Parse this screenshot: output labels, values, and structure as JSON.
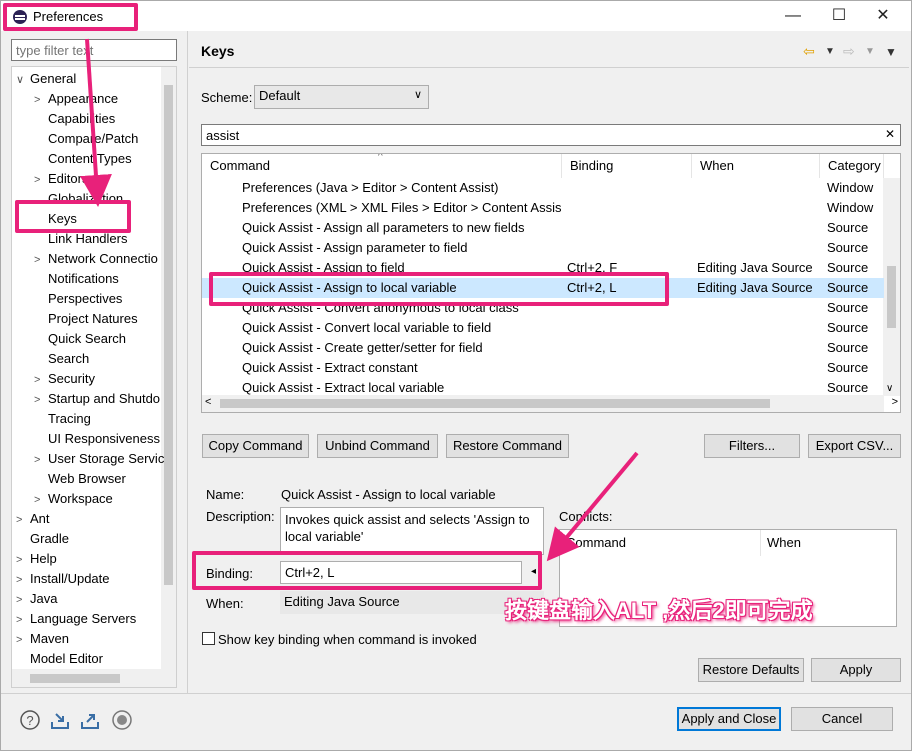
{
  "window": {
    "title": "Preferences",
    "minimize": "—",
    "maximize": "☐",
    "close": "✕"
  },
  "filter": {
    "placeholder": "type filter text"
  },
  "tree": [
    {
      "label": "General",
      "tw": "∨",
      "indent": 0
    },
    {
      "label": "Appearance",
      "tw": ">",
      "indent": 1
    },
    {
      "label": "Capabilities",
      "tw": "",
      "indent": 1
    },
    {
      "label": "Compare/Patch",
      "tw": "",
      "indent": 1
    },
    {
      "label": "Content Types",
      "tw": "",
      "indent": 1
    },
    {
      "label": "Editors",
      "tw": ">",
      "indent": 1
    },
    {
      "label": "Globalization",
      "tw": "",
      "indent": 1
    },
    {
      "label": "Keys",
      "tw": "",
      "indent": 1
    },
    {
      "label": "Link Handlers",
      "tw": "",
      "indent": 1
    },
    {
      "label": "Network Connectio",
      "tw": ">",
      "indent": 1
    },
    {
      "label": "Notifications",
      "tw": "",
      "indent": 1
    },
    {
      "label": "Perspectives",
      "tw": "",
      "indent": 1
    },
    {
      "label": "Project Natures",
      "tw": "",
      "indent": 1
    },
    {
      "label": "Quick Search",
      "tw": "",
      "indent": 1
    },
    {
      "label": "Search",
      "tw": "",
      "indent": 1
    },
    {
      "label": "Security",
      "tw": ">",
      "indent": 1
    },
    {
      "label": "Startup and Shutdo",
      "tw": ">",
      "indent": 1
    },
    {
      "label": "Tracing",
      "tw": "",
      "indent": 1
    },
    {
      "label": "UI Responsiveness",
      "tw": "",
      "indent": 1
    },
    {
      "label": "User Storage Servic",
      "tw": ">",
      "indent": 1
    },
    {
      "label": "Web Browser",
      "tw": "",
      "indent": 1
    },
    {
      "label": "Workspace",
      "tw": ">",
      "indent": 1
    },
    {
      "label": "Ant",
      "tw": ">",
      "indent": 0
    },
    {
      "label": "Gradle",
      "tw": "",
      "indent": 0
    },
    {
      "label": "Help",
      "tw": ">",
      "indent": 0
    },
    {
      "label": "Install/Update",
      "tw": ">",
      "indent": 0
    },
    {
      "label": "Java",
      "tw": ">",
      "indent": 0
    },
    {
      "label": "Language Servers",
      "tw": ">",
      "indent": 0
    },
    {
      "label": "Maven",
      "tw": ">",
      "indent": 0
    },
    {
      "label": "Model Editor",
      "tw": "",
      "indent": 0
    }
  ],
  "page": {
    "title": "Keys"
  },
  "scheme": {
    "label": "Scheme:",
    "value": "Default"
  },
  "search": {
    "value": "assist"
  },
  "table": {
    "headers": [
      "Command",
      "Binding",
      "When",
      "Category"
    ],
    "rows": [
      [
        "Preferences (Java > Editor > Content Assist)",
        "",
        "",
        "Window"
      ],
      [
        "Preferences (XML > XML Files > Editor > Content Assis",
        "",
        "",
        "Window"
      ],
      [
        "Quick Assist - Assign all parameters to new fields",
        "",
        "",
        "Source"
      ],
      [
        "Quick Assist - Assign parameter to field",
        "",
        "",
        "Source"
      ],
      [
        "Quick Assist - Assign to field",
        "Ctrl+2, F",
        "Editing Java Source",
        "Source"
      ],
      [
        "Quick Assist - Assign to local variable",
        "Ctrl+2, L",
        "Editing Java Source",
        "Source"
      ],
      [
        "Quick Assist - Convert anonymous to local class",
        "",
        "",
        "Source"
      ],
      [
        "Quick Assist - Convert local variable to field",
        "",
        "",
        "Source"
      ],
      [
        "Quick Assist - Create getter/setter for field",
        "",
        "",
        "Source"
      ],
      [
        "Quick Assist - Extract constant",
        "",
        "",
        "Source"
      ],
      [
        "Quick Assist - Extract local variable",
        "",
        "",
        "Source"
      ]
    ],
    "selected_index": 5
  },
  "buttons": {
    "copy": "Copy Command",
    "unbind": "Unbind Command",
    "restore": "Restore Command",
    "filters": "Filters...",
    "export": "Export CSV...",
    "restore_defaults": "Restore Defaults",
    "apply": "Apply",
    "apply_close": "Apply and Close",
    "cancel": "Cancel"
  },
  "details": {
    "name_label": "Name:",
    "name_value": "Quick Assist - Assign to local variable",
    "desc_label": "Description:",
    "desc_value": "Invokes quick assist and selects 'Assign to local variable'",
    "binding_label": "Binding:",
    "binding_value": "Ctrl+2, L",
    "when_label": "When:",
    "when_value": "Editing Java Source",
    "conflicts_label": "Conflicts:",
    "conflicts_headers": [
      "Command",
      "When"
    ]
  },
  "show_binding": {
    "label": "Show key binding when command is invoked"
  },
  "annotation": "按键盘输入ALT ,然后2即可完成",
  "icons": [
    "help-icon",
    "import-icon",
    "export-icon",
    "record-icon"
  ],
  "colors": {
    "highlight": "#e8217a",
    "selection": "#cce8ff",
    "accent": "#0078d7"
  }
}
